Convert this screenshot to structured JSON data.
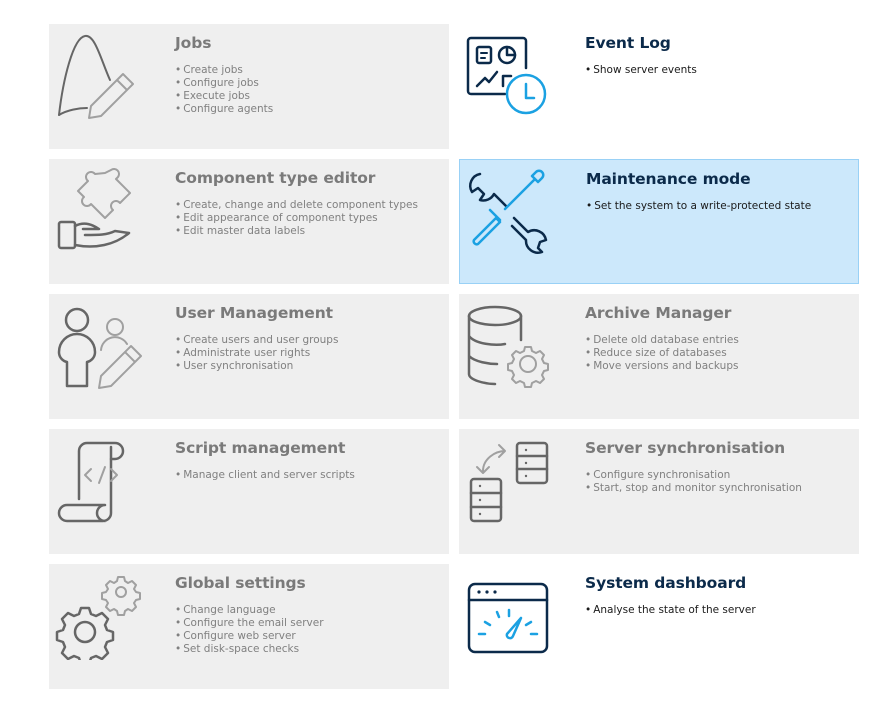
{
  "tiles": [
    {
      "id": "jobs",
      "title": "Jobs",
      "state": "disabled",
      "icon": "jobs-pencil-icon",
      "bullets": [
        "Create jobs",
        "Configure jobs",
        "Execute jobs",
        "Configure agents"
      ]
    },
    {
      "id": "event-log",
      "title": "Event Log",
      "state": "active",
      "icon": "event-log-clock-icon",
      "bullets": [
        "Show server events"
      ]
    },
    {
      "id": "component-type-editor",
      "title": "Component type editor",
      "state": "disabled",
      "icon": "puzzle-hand-icon",
      "bullets": [
        "Create, change and delete component types",
        "Edit appearance of component types",
        "Edit master data labels"
      ]
    },
    {
      "id": "maintenance-mode",
      "title": "Maintenance mode",
      "state": "selected",
      "icon": "wrench-screwdriver-icon",
      "bullets": [
        "Set the system to a write-protected state"
      ]
    },
    {
      "id": "user-management",
      "title": "User Management",
      "state": "disabled",
      "icon": "users-pencil-icon",
      "bullets": [
        "Create users and user groups",
        "Administrate user rights",
        "User synchronisation"
      ]
    },
    {
      "id": "archive-manager",
      "title": "Archive Manager",
      "state": "disabled",
      "icon": "database-gear-icon",
      "bullets": [
        "Delete old database entries",
        "Reduce size of databases",
        "Move versions and backups"
      ]
    },
    {
      "id": "script-management",
      "title": "Script management",
      "state": "disabled",
      "icon": "script-scroll-icon",
      "bullets": [
        "Manage client and server scripts"
      ]
    },
    {
      "id": "server-synchronisation",
      "title": "Server synchronisation",
      "state": "disabled",
      "icon": "server-sync-icon",
      "bullets": [
        "Configure synchronisation",
        "Start, stop and monitor synchronisation"
      ]
    },
    {
      "id": "global-settings",
      "title": "Global settings",
      "state": "disabled",
      "icon": "gears-icon",
      "bullets": [
        "Change language",
        "Configure the email server",
        "Configure web server",
        "Set disk-space checks"
      ]
    },
    {
      "id": "system-dashboard",
      "title": "System dashboard",
      "state": "active",
      "icon": "dashboard-gauge-icon",
      "bullets": [
        "Analyse the state of the server"
      ]
    }
  ],
  "colors": {
    "dark_navy": "#0b2a4a",
    "accent_blue": "#1ba1e2",
    "disabled_bg": "#efefef",
    "selected_bg": "#cce8fb",
    "selected_border": "#99d1f6",
    "disabled_text": "#7a7a7a"
  }
}
